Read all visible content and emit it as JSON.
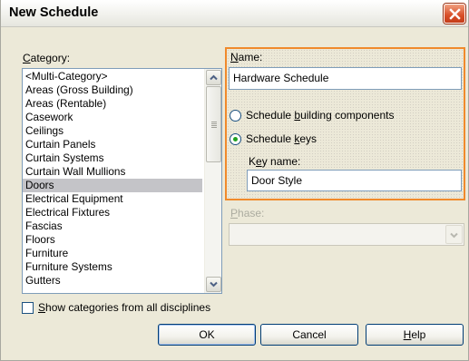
{
  "window": {
    "title": "New Schedule"
  },
  "category": {
    "label": "Category:",
    "items": [
      "<Multi-Category>",
      "Areas (Gross Building)",
      "Areas (Rentable)",
      "Casework",
      "Ceilings",
      "Curtain Panels",
      "Curtain Systems",
      "Curtain Wall Mullions",
      "Doors",
      "Electrical Equipment",
      "Electrical Fixtures",
      "Fascias",
      "Floors",
      "Furniture",
      "Furniture Systems",
      "Gutters"
    ],
    "selected": "Doors"
  },
  "show_all": {
    "label": "Show categories from all disciplines",
    "checked": false
  },
  "name": {
    "label": "Name:",
    "value": "Hardware Schedule"
  },
  "schedule_type": {
    "option1": "Schedule building components",
    "option2": "Schedule keys",
    "selected": "Schedule keys"
  },
  "key_name": {
    "label": "Key name:",
    "value": "Door Style"
  },
  "phase": {
    "label": "Phase:",
    "value": ""
  },
  "buttons": {
    "ok": "OK",
    "cancel": "Cancel",
    "help": "Help"
  },
  "colors": {
    "focus_border": "#f08a2c",
    "selection": "#c4c4c8",
    "close_button": "#d84e28"
  }
}
